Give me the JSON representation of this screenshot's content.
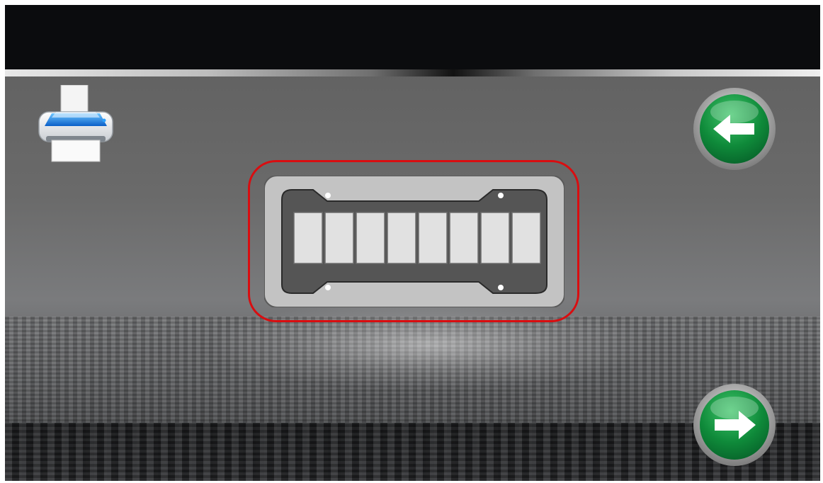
{
  "screen": {
    "background": "#666768",
    "accent_selection": "#d90d10"
  },
  "toolbar": {
    "print_icon": "printer-icon"
  },
  "navigation": {
    "back_icon": "arrow-left-icon",
    "next_icon": "arrow-right-icon",
    "button_color": "#0f8a3a"
  },
  "plate": {
    "icon": "license-plate-frame-icon",
    "selected": true,
    "character_slots": 8
  }
}
